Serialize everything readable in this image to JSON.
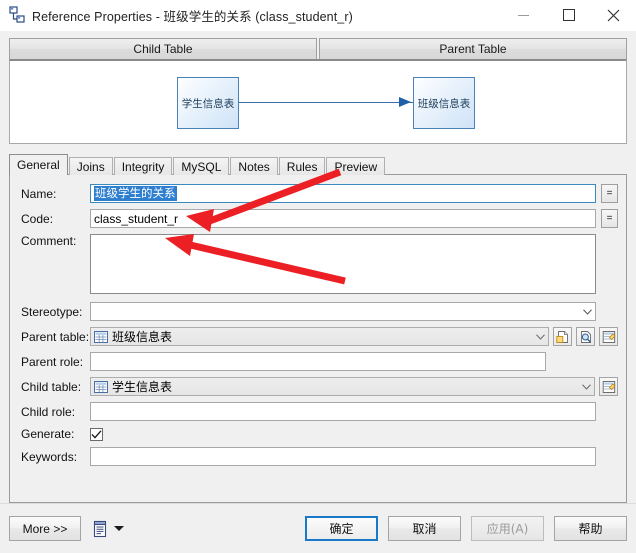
{
  "window": {
    "title": "Reference Properties - 班级学生的关系 (class_student_r)",
    "icon": "reference-icon",
    "minimize_label": "",
    "maximize_label": "",
    "close_label": ""
  },
  "diagram": {
    "headers": [
      {
        "label": "Child Table"
      },
      {
        "label": "Parent Table"
      }
    ],
    "child_entity": "学生信息表",
    "parent_entity": "班级信息表"
  },
  "tabs": [
    {
      "label": "General",
      "active": true
    },
    {
      "label": "Joins",
      "active": false
    },
    {
      "label": "Integrity",
      "active": false
    },
    {
      "label": "MySQL",
      "active": false
    },
    {
      "label": "Notes",
      "active": false
    },
    {
      "label": "Rules",
      "active": false
    },
    {
      "label": "Preview",
      "active": false
    }
  ],
  "form": {
    "name": {
      "label": "Name:",
      "value": "班级学生的关系",
      "selected": true,
      "ellipsis_button": "=",
      "placeholder": ""
    },
    "code": {
      "label": "Code:",
      "value": "class_student_r",
      "ellipsis_button": "=",
      "placeholder": ""
    },
    "comment": {
      "label": "Comment:",
      "value": "",
      "placeholder": ""
    },
    "stereotype": {
      "label": "Stereotype:",
      "value": "",
      "placeholder": ""
    },
    "parent_table": {
      "label": "Parent table:",
      "value": "班级信息表",
      "icon": "table-icon",
      "buttons": [
        {
          "name": "create-object-button",
          "icon": "new-object-icon"
        },
        {
          "name": "find-object-button",
          "icon": "magnifier-icon"
        },
        {
          "name": "properties-button",
          "icon": "properties-icon"
        }
      ]
    },
    "parent_role": {
      "label": "Parent role:",
      "value": "",
      "placeholder": ""
    },
    "child_table": {
      "label": "Child table:",
      "value": "学生信息表",
      "icon": "table-icon",
      "buttons": [
        {
          "name": "properties-button",
          "icon": "properties-icon"
        }
      ]
    },
    "child_role": {
      "label": "Child role:",
      "value": "",
      "placeholder": ""
    },
    "generate": {
      "label": "Generate:",
      "checked": true
    },
    "keywords": {
      "label": "Keywords:",
      "value": "",
      "placeholder": ""
    }
  },
  "footer": {
    "more": "More >>",
    "report_icon": "report-icon",
    "ok": "确定",
    "cancel": "取消",
    "apply": "应用(A)",
    "apply_disabled": true,
    "help": "帮助"
  },
  "annotations": {
    "color": "#ec2024",
    "arrows": [
      {
        "name": "arrow-to-name-field",
        "target": "name-field"
      },
      {
        "name": "arrow-to-code-field",
        "target": "code-field"
      }
    ]
  },
  "colors": {
    "accent": "#1979c8",
    "selection": "#2f7fd1",
    "entity_border": "#4a82b8",
    "annotation_red": "#ec2024",
    "window_bg": "#f0f0f0"
  }
}
